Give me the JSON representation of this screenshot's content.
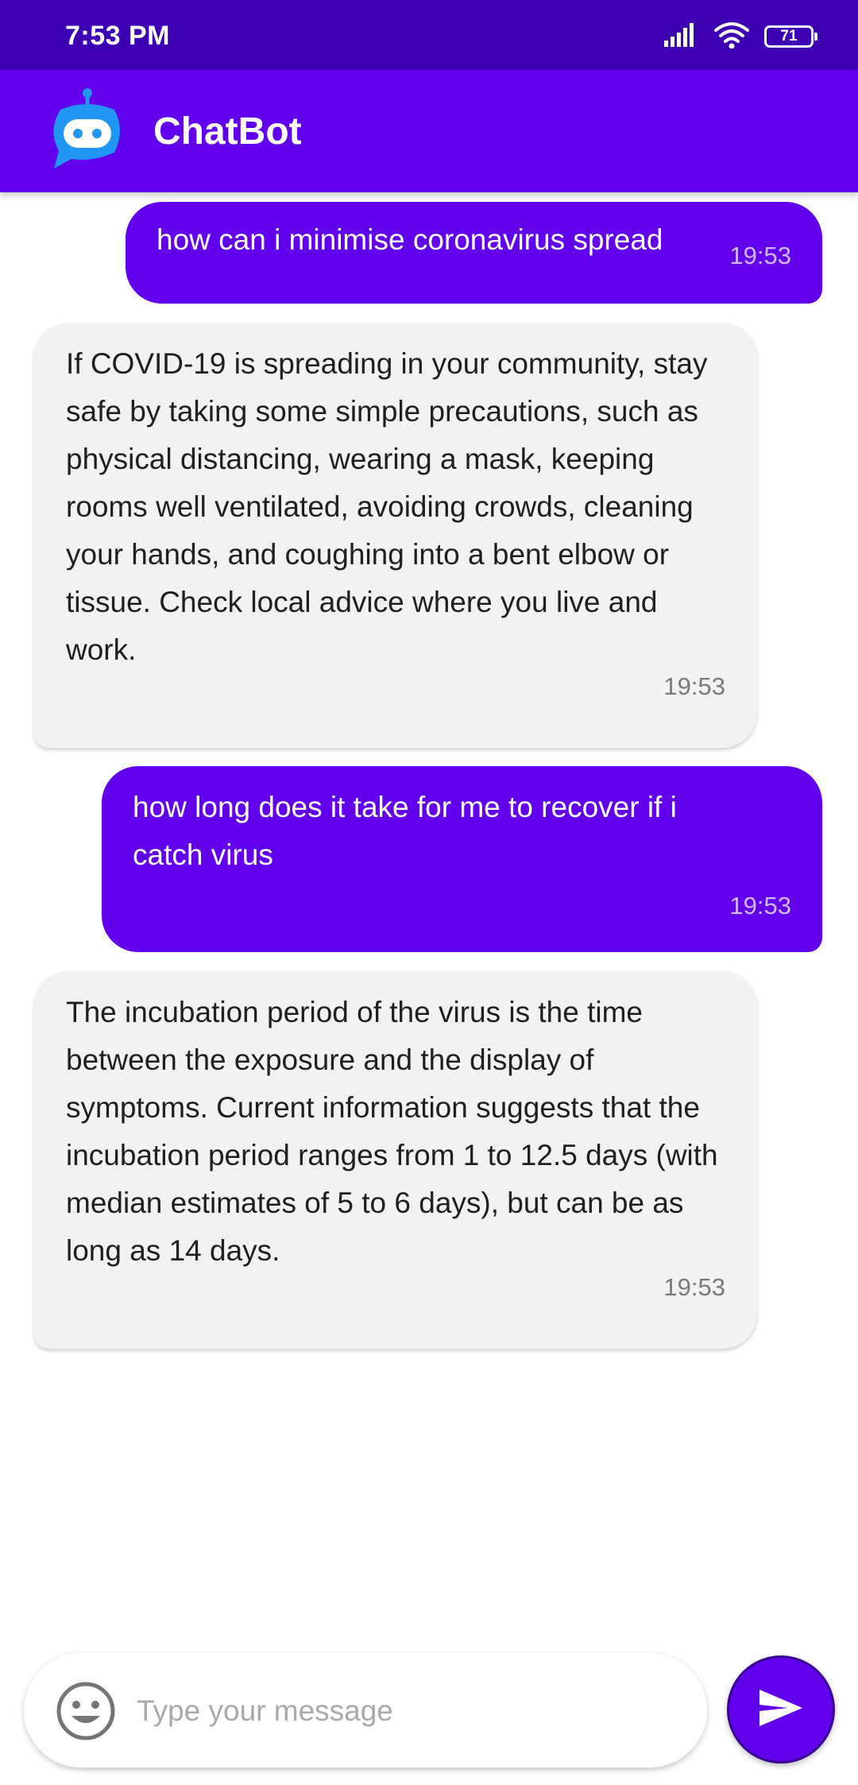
{
  "status_bar": {
    "time": "7:53 PM",
    "battery_level": "71",
    "icons": [
      "signal-icon",
      "wifi-icon",
      "battery-icon"
    ]
  },
  "app_bar": {
    "title": "ChatBot",
    "logo_icon": "robot-icon"
  },
  "chat": {
    "messages": [
      {
        "sender": "user",
        "text": "how can i minimise coronavirus spread",
        "time": "19:53"
      },
      {
        "sender": "bot",
        "text": "If COVID-19 is spreading in your community, stay safe by taking some simple precautions, such as physical distancing, wearing a mask, keeping rooms well ventilated, avoiding crowds, cleaning your hands, and coughing into a bent elbow or tissue. Check local advice where you live and work.",
        "time": "19:53"
      },
      {
        "sender": "user",
        "text": "how long does it take for me to recover if i catch virus",
        "time": "19:53"
      },
      {
        "sender": "bot",
        "text": "The incubation period of the virus is the time between the exposure and the display of symptoms. Current information suggests that the incubation period ranges from 1 to 12.5 days (with median estimates of 5 to 6 days), but can be as long as 14 days.",
        "time": "19:53"
      }
    ]
  },
  "input_bar": {
    "placeholder": "Type your message",
    "value": "",
    "emoji_icon": "emoji-icon",
    "send_icon": "send-icon"
  },
  "colors": {
    "status_bar": "#3d00b3",
    "primary": "#6200ee",
    "bot_bubble": "#f2f2f2",
    "logo_blue": "#2196f3"
  }
}
